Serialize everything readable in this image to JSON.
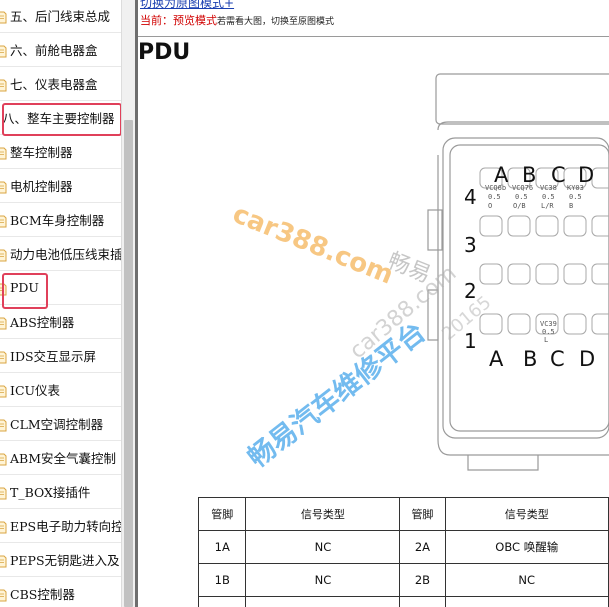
{
  "sidebar": {
    "items": [
      {
        "label": "五、后门线束总成",
        "icon": "folder-icon"
      },
      {
        "label": "六、前舱电器盒",
        "icon": "folder-icon"
      },
      {
        "label": "七、仪表电器盒",
        "icon": "folder-icon"
      },
      {
        "label": "八、整车主要控制器",
        "icon": "none"
      },
      {
        "label": "整车控制器",
        "icon": "folder-icon"
      },
      {
        "label": "电机控制器",
        "icon": "folder-icon"
      },
      {
        "label": "BCM车身控制器",
        "icon": "folder-icon"
      },
      {
        "label": "动力电池低压线束插",
        "icon": "folder-icon"
      },
      {
        "label": "PDU",
        "icon": "folder-icon"
      },
      {
        "label": "ABS控制器",
        "icon": "folder-icon"
      },
      {
        "label": "IDS交互显示屏",
        "icon": "folder-icon"
      },
      {
        "label": "ICU仪表",
        "icon": "folder-icon"
      },
      {
        "label": "CLM空调控制器",
        "icon": "folder-icon"
      },
      {
        "label": "ABM安全气囊控制",
        "icon": "folder-icon"
      },
      {
        "label": "T_BOX接插件",
        "icon": "folder-icon"
      },
      {
        "label": "EPS电子助力转向控",
        "icon": "folder-icon"
      },
      {
        "label": "PEPS无钥匙进入及",
        "icon": "folder-icon"
      },
      {
        "label": "CBS控制器",
        "icon": "folder-icon"
      }
    ],
    "highlight_color": "#e0405a"
  },
  "header": {
    "switch_link": "切换为原图模式+",
    "mode_prefix": "当前：",
    "mode_name": "预览模式",
    "mode_hint": "若需看大图，切换至原图模式"
  },
  "page_title": "PDU",
  "connector": {
    "cols_top": [
      "A",
      "B",
      "C",
      "D"
    ],
    "cols_bottom": [
      "A",
      "B",
      "C",
      "D"
    ],
    "rows": [
      "4",
      "3",
      "2",
      "1"
    ],
    "row4_wires": [
      {
        "code": "VCQ6b",
        "size": "0.5",
        "color": "O"
      },
      {
        "code": "VCQ76",
        "size": "0.5",
        "color": "O/B"
      },
      {
        "code": "VC38",
        "size": "0.5",
        "color": "L/R"
      },
      {
        "code": "KY03",
        "size": "0.5",
        "color": "B"
      }
    ],
    "row1_wire": {
      "code": "VC39",
      "size": "0.5",
      "color": "L"
    }
  },
  "watermarks": {
    "wm1": "car388.com",
    "wm2": "畅易",
    "wm3": "car388.com",
    "wm4": "畅易汽车维修平台",
    "wm5": "20165"
  },
  "pin_table": {
    "headers": [
      "管脚",
      "信号类型",
      "管脚",
      "信号类型"
    ],
    "rows": [
      [
        "1A",
        "NC",
        "2A",
        "OBC 唤醒输"
      ],
      [
        "1B",
        "NC",
        "2B",
        "NC"
      ]
    ]
  }
}
